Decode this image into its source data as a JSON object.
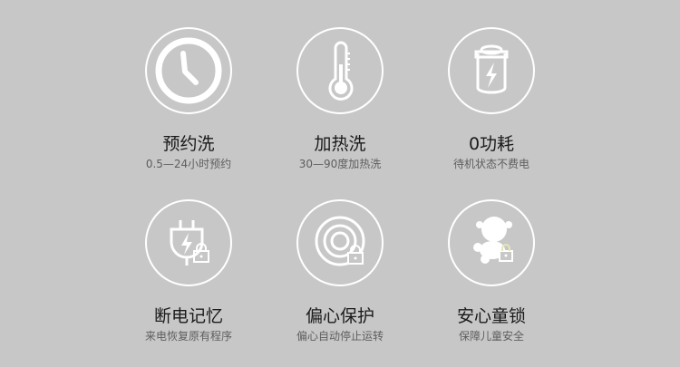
{
  "features": [
    {
      "icon": "clock-icon",
      "title": "预约洗",
      "subtitle": "0.5—24小时预约"
    },
    {
      "icon": "thermometer-icon",
      "title": "加热洗",
      "subtitle": "30—90度加热洗"
    },
    {
      "icon": "battery-icon",
      "title": "0功耗",
      "subtitle": "待机状态不费电"
    },
    {
      "icon": "plug-lock-icon",
      "title": "断电记忆",
      "subtitle": "来电恢复原有程序"
    },
    {
      "icon": "drum-lock-icon",
      "title": "偏心保护",
      "subtitle": "偏心自动停止运转"
    },
    {
      "icon": "child-lock-icon",
      "title": "安心童锁",
      "subtitle": "保障儿童安全"
    }
  ],
  "colors": {
    "background": "#c7c7c7",
    "icon_stroke": "#ffffff",
    "title": "#1a1a1a",
    "subtitle": "#5e5e5e"
  }
}
